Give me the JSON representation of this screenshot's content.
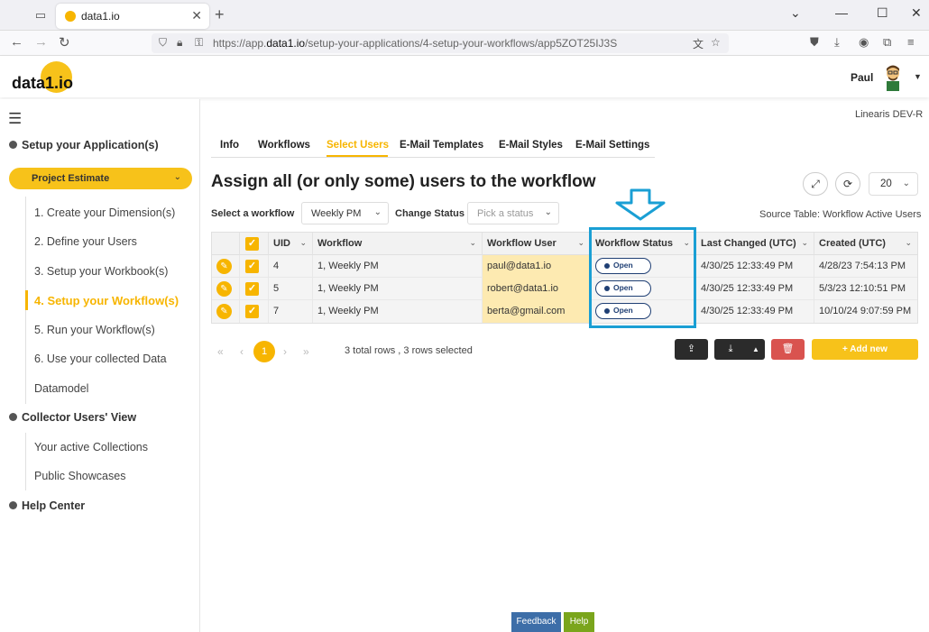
{
  "browser": {
    "tab_title": "data1.io",
    "url_prefix": "https://app.",
    "url_domain": "data1.io",
    "url_path": "/setup-your-applications/4-setup-your-workflows/app5ZOT25IJ3S"
  },
  "header": {
    "logo": "data1.io",
    "user_name": "Paul"
  },
  "sidebar": {
    "sections": [
      "Setup your Application(s)",
      "Collector Users' View",
      "Help Center"
    ],
    "project": "Project Estimate",
    "setup_items": [
      "1. Create your Dimension(s)",
      "2. Define your Users",
      "3. Setup your Workbook(s)",
      "4. Setup your Workflow(s)",
      "5. Run your Workflow(s)",
      "6. Use your collected Data",
      "Datamodel"
    ],
    "collector_items": [
      "Your active Collections",
      "Public Showcases"
    ]
  },
  "main": {
    "env": "Linearis DEV-R",
    "tabs": [
      "Info",
      "Workflows",
      "Select Users",
      "E-Mail Templates",
      "E-Mail Styles",
      "E-Mail Settings"
    ],
    "title": "Assign all (or only some) users to the workflow",
    "page_size": "20",
    "select_workflow_label": "Select a workflow",
    "select_workflow_value": "Weekly PM",
    "change_status_label": "Change Status",
    "change_status_placeholder": "Pick a status",
    "source_table": "Source Table: Workflow Active Users",
    "columns": [
      "UID",
      "Workflow",
      "Workflow User",
      "Workflow Status",
      "Last Changed (UTC)",
      "Created (UTC)"
    ],
    "rows": [
      {
        "uid": "4",
        "workflow": "1, Weekly PM",
        "user": "paul@data1.io",
        "status": "Open",
        "changed": "4/30/25 12:33:49 PM",
        "created": "4/28/23 7:54:13 PM"
      },
      {
        "uid": "5",
        "workflow": "1, Weekly PM",
        "user": "robert@data1.io",
        "status": "Open",
        "changed": "4/30/25 12:33:49 PM",
        "created": "5/3/23 12:10:51 PM"
      },
      {
        "uid": "7",
        "workflow": "1, Weekly PM",
        "user": "berta@gmail.com",
        "status": "Open",
        "changed": "4/30/25 12:33:49 PM",
        "created": "10/10/24 9:07:59 PM"
      }
    ],
    "current_page": "1",
    "rows_info": "3 total rows , 3 rows selected",
    "add_new": "+ Add new"
  },
  "footer": {
    "feedback": "Feedback",
    "help": "Help"
  },
  "colors": {
    "accent": "#f7b500",
    "highlight": "#1a9fd4",
    "status": "#1f3f74"
  }
}
